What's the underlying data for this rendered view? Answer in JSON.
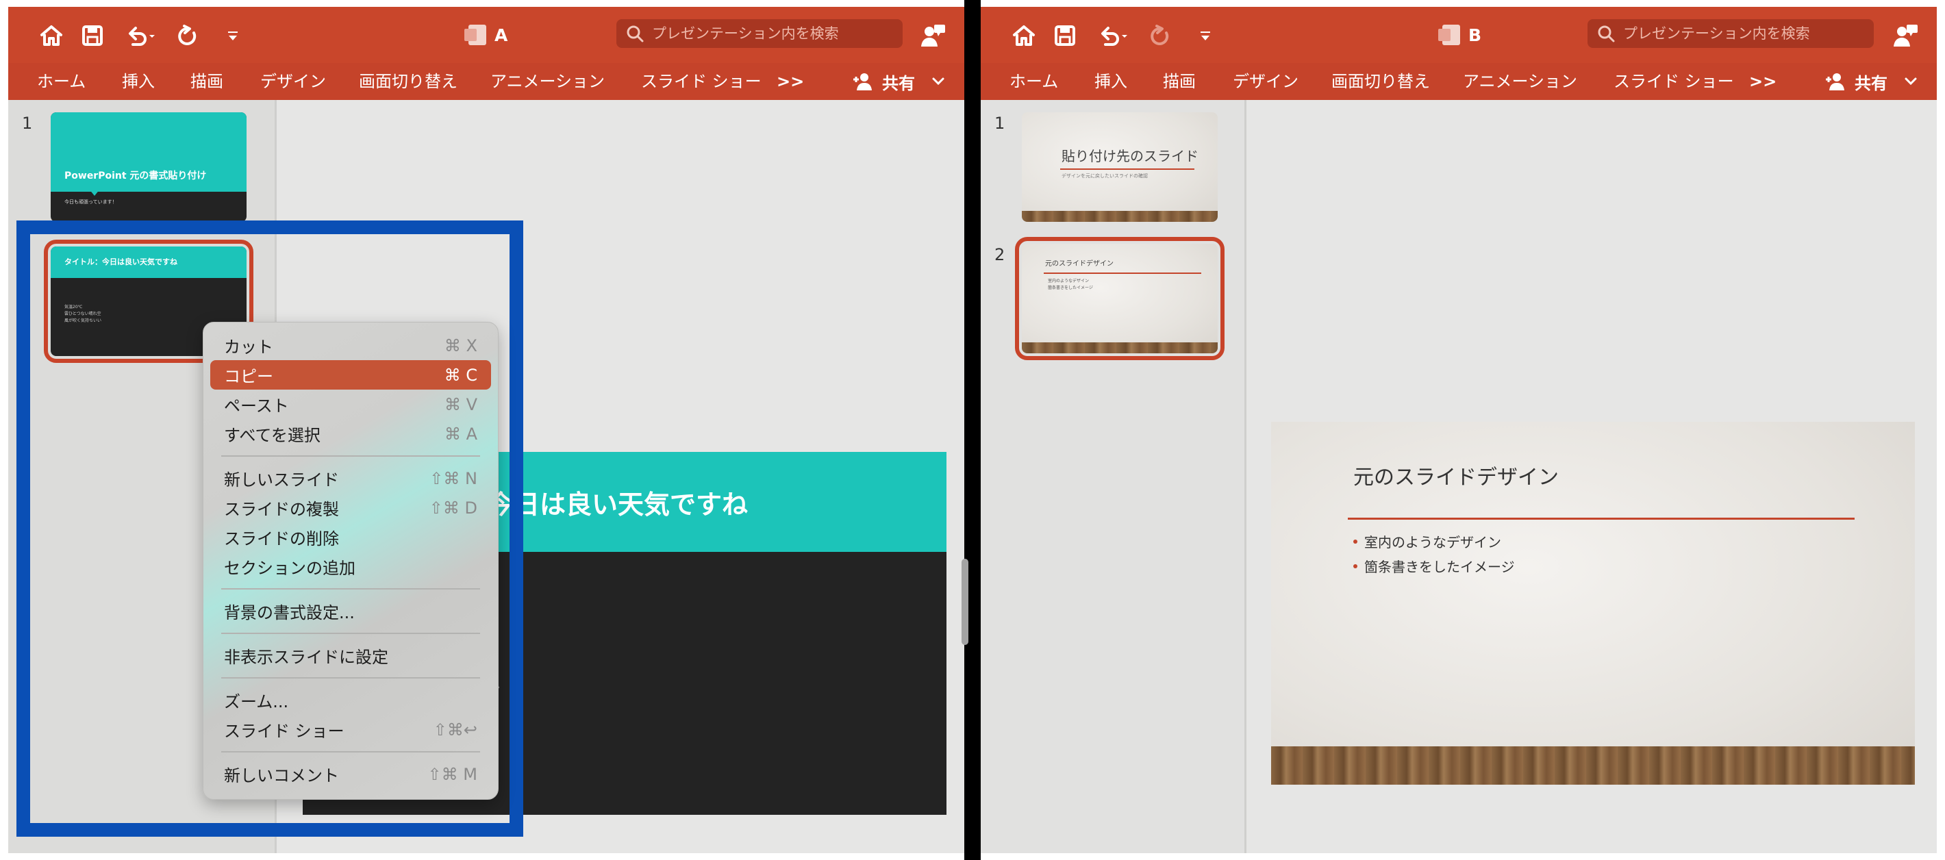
{
  "colors": {
    "title_bar": "#c9462b",
    "teal": "#1cc4b9",
    "selection_blue": "#0a4fb5",
    "highlight": "#c55436"
  },
  "window_a": {
    "doc_name": "A",
    "search_placeholder": "プレゼンテーション内を検索",
    "tabs": [
      "ホーム",
      "挿入",
      "描画",
      "デザイン",
      "画面切り替え",
      "アニメーション",
      "スライド ショー"
    ],
    "more": ">>",
    "share": "共有",
    "slides": [
      {
        "number": "1",
        "title": "PowerPoint 元の書式貼り付け",
        "subtitle": "今日も頑張っています！"
      },
      {
        "number": "2",
        "title": "タイトル：今日は良い天気ですね",
        "bullets": [
          "気温20℃",
          "雲ひとつない晴れ空",
          "風が吹く気持ちいい"
        ]
      }
    ],
    "main_slide_title": "今日は良い天気ですね",
    "main_slide_fragment": "い",
    "context_menu": [
      {
        "label": "カット",
        "shortcut": "⌘ X"
      },
      {
        "label": "コピー",
        "shortcut": "⌘ C",
        "highlighted": true
      },
      {
        "label": "ペースト",
        "shortcut": "⌘ V"
      },
      {
        "label": "すべてを選択",
        "shortcut": "⌘ A"
      },
      {
        "separator": true
      },
      {
        "label": "新しいスライド",
        "shortcut": "⇧⌘ N"
      },
      {
        "label": "スライドの複製",
        "shortcut": "⇧⌘ D"
      },
      {
        "label": "スライドの削除",
        "shortcut": ""
      },
      {
        "label": "セクションの追加",
        "shortcut": ""
      },
      {
        "separator": true
      },
      {
        "label": "背景の書式設定...",
        "shortcut": ""
      },
      {
        "separator": true
      },
      {
        "label": "非表示スライドに設定",
        "shortcut": ""
      },
      {
        "separator": true
      },
      {
        "label": "ズーム...",
        "shortcut": ""
      },
      {
        "label": "スライド ショー",
        "shortcut": "⇧⌘↩"
      },
      {
        "separator": true
      },
      {
        "label": "新しいコメント",
        "shortcut": "⇧⌘ M"
      }
    ]
  },
  "window_b": {
    "doc_name": "B",
    "search_placeholder": "プレゼンテーション内を検索",
    "tabs": [
      "ホーム",
      "挿入",
      "描画",
      "デザイン",
      "画面切り替え",
      "アニメーション",
      "スライド ショー"
    ],
    "more": ">>",
    "share": "共有",
    "slides": [
      {
        "number": "1",
        "title": "貼り付け先のスライド",
        "subtitle": "デザインを元に戻したいスライドの確認"
      },
      {
        "number": "2",
        "title": "元のスライドデザイン",
        "bullets": [
          "室内のようなデザイン",
          "箇条書きをしたイメージ"
        ]
      }
    ],
    "main_slide": {
      "title": "元のスライドデザイン",
      "bullets": [
        "室内のようなデザイン",
        "箇条書きをしたイメージ"
      ]
    }
  }
}
